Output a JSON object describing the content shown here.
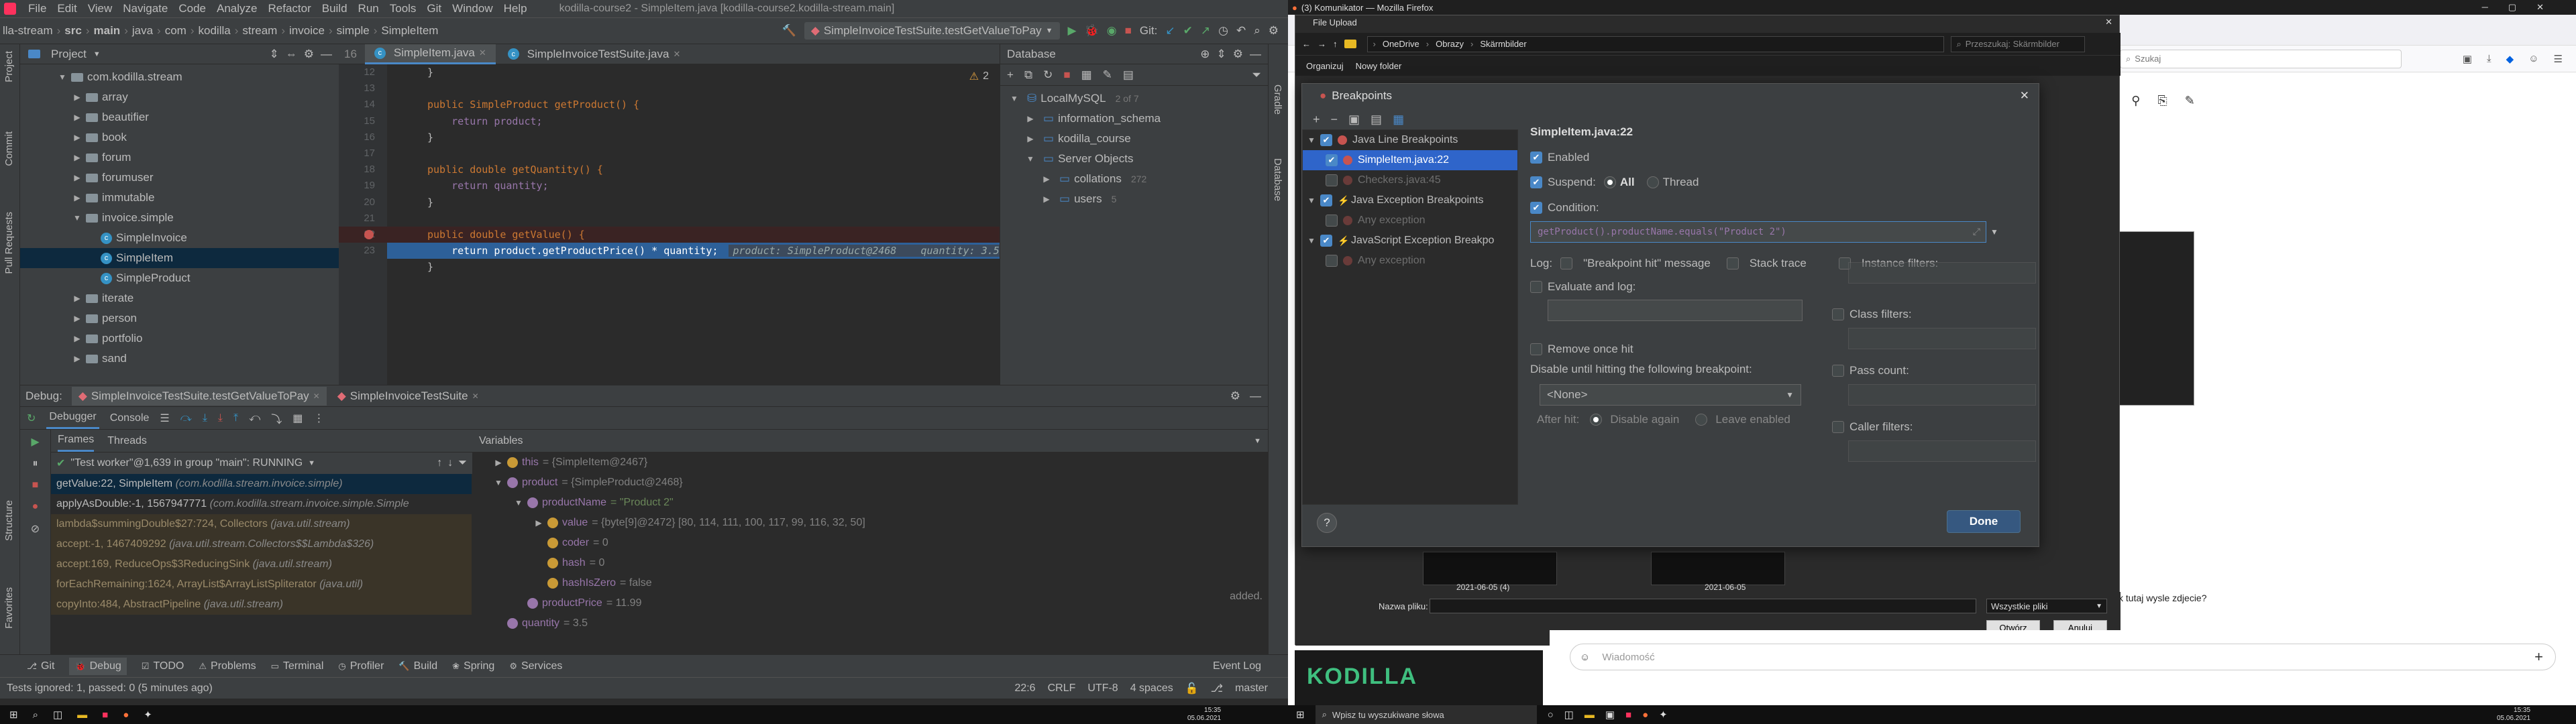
{
  "ide": {
    "menu": [
      "File",
      "Edit",
      "View",
      "Navigate",
      "Code",
      "Analyze",
      "Refactor",
      "Build",
      "Run",
      "Tools",
      "Git",
      "Window",
      "Help"
    ],
    "window_title": "kodilla-course2 - SimpleItem.java [kodilla-course2.kodilla-stream.main]",
    "breadcrumb": [
      "lla-stream",
      "src",
      "main",
      "java",
      "com",
      "kodilla",
      "stream",
      "invoice",
      "simple",
      "SimpleItem"
    ],
    "run_config": "SimpleInvoiceTestSuite.testGetValueToPay",
    "git_label": "Git:",
    "project": {
      "title": "Project",
      "tree": [
        {
          "label": "com.kodilla.stream",
          "type": "package",
          "indent": 3,
          "open": true
        },
        {
          "label": "array",
          "type": "package",
          "indent": 4
        },
        {
          "label": "beautifier",
          "type": "package",
          "indent": 4
        },
        {
          "label": "book",
          "type": "package",
          "indent": 4
        },
        {
          "label": "forum",
          "type": "package",
          "indent": 4
        },
        {
          "label": "forumuser",
          "type": "package",
          "indent": 4
        },
        {
          "label": "immutable",
          "type": "package",
          "indent": 4
        },
        {
          "label": "invoice.simple",
          "type": "package",
          "indent": 4,
          "open": true
        },
        {
          "label": "SimpleInvoice",
          "type": "class",
          "indent": 5
        },
        {
          "label": "SimpleItem",
          "type": "class",
          "indent": 5,
          "selected": true
        },
        {
          "label": "SimpleProduct",
          "type": "class",
          "indent": 5
        },
        {
          "label": "iterate",
          "type": "package",
          "indent": 4
        },
        {
          "label": "person",
          "type": "package",
          "indent": 4
        },
        {
          "label": "portfolio",
          "type": "package",
          "indent": 4
        },
        {
          "label": "sand",
          "type": "package",
          "indent": 4
        }
      ],
      "badge": "16"
    },
    "editor": {
      "tabs": [
        {
          "label": "SimpleItem.java",
          "active": true
        },
        {
          "label": "SimpleInvoiceTestSuite.java",
          "active": false
        }
      ],
      "warnings": "2",
      "line_numbers": [
        "12",
        "13",
        "14",
        "15",
        "16",
        "17",
        "18",
        "19",
        "20",
        "21",
        "22",
        "23"
      ],
      "lines": [
        {
          "t": "}"
        },
        {
          "t": ""
        },
        {
          "t": "public SimpleProduct getProduct() {"
        },
        {
          "t": "    return product;"
        },
        {
          "t": "}"
        },
        {
          "t": ""
        },
        {
          "t": "public double getQuantity() {"
        },
        {
          "t": "    return quantity;"
        },
        {
          "t": "}"
        },
        {
          "t": ""
        },
        {
          "t": "public double getValue() {"
        },
        {
          "t": "    return product.getProductPrice() * quantity;"
        },
        {
          "t": "}"
        }
      ],
      "inline_debug": "product: SimpleProduct@2468    quantity: 3.5"
    },
    "database": {
      "title": "Database",
      "items": [
        {
          "label": "LocalMySQL",
          "count": "2 of 7",
          "indent": 0
        },
        {
          "label": "information_schema",
          "indent": 1
        },
        {
          "label": "kodilla_course",
          "indent": 1
        },
        {
          "label": "Server Objects",
          "indent": 1,
          "open": true
        },
        {
          "label": "collations",
          "count": "272",
          "indent": 2
        },
        {
          "label": "users",
          "count": "5",
          "indent": 2
        }
      ]
    },
    "debug": {
      "label": "Debug:",
      "tabs": [
        "SimpleInvoiceTestSuite.testGetValueToPay",
        "SimpleInvoiceTestSuite"
      ],
      "subtabs": [
        "Debugger",
        "Console"
      ],
      "frames_tab": "Frames",
      "threads_tab": "Threads",
      "variables_tab": "Variables",
      "thread": "\"Test worker\"@1,639 in group \"main\": RUNNING",
      "frames": [
        {
          "m": "getValue:22, SimpleItem",
          "c": "(com.kodilla.stream.invoice.simple)",
          "sel": true
        },
        {
          "m": "applyAsDouble:-1, 1567947771",
          "c": "(com.kodilla.stream.invoice.simple.Simple"
        },
        {
          "m": "lambda$summingDouble$27:724, Collectors",
          "c": "(java.util.stream)",
          "lib": true
        },
        {
          "m": "accept:-1, 1467409292",
          "c": "(java.util.stream.Collectors$$Lambda$326)",
          "lib": true
        },
        {
          "m": "accept:169, ReduceOps$3ReducingSink",
          "c": "(java.util.stream)",
          "lib": true
        },
        {
          "m": "forEachRemaining:1624, ArrayList$ArrayListSpliterator",
          "c": "(java.util)",
          "lib": true
        },
        {
          "m": "copyInto:484, AbstractPipeline",
          "c": "(java.util.stream)",
          "lib": true
        }
      ],
      "variables": [
        {
          "indent": 0,
          "name": "this",
          "val": "= {SimpleItem@2467}",
          "arrow": "▶"
        },
        {
          "indent": 0,
          "name": "product",
          "val": "= {SimpleProduct@2468}",
          "arrow": "▼"
        },
        {
          "indent": 1,
          "name": "productName",
          "val": "= \"Product 2\"",
          "str": true,
          "arrow": "▼"
        },
        {
          "indent": 2,
          "name": "value",
          "val": "= {byte[9]@2472} [80, 114, 111, 100, 117, 99, 116, 32, 50]",
          "arrow": "▶"
        },
        {
          "indent": 2,
          "name": "coder",
          "val": "= 0"
        },
        {
          "indent": 2,
          "name": "hash",
          "val": "= 0"
        },
        {
          "indent": 2,
          "name": "hashIsZero",
          "val": "= false"
        },
        {
          "indent": 1,
          "name": "productPrice",
          "val": "= 11.99"
        },
        {
          "indent": 0,
          "name": "quantity",
          "val": "= 3.5"
        }
      ],
      "side_text": "added."
    },
    "bottom_tools": [
      "Git",
      "Debug",
      "TODO",
      "Problems",
      "Terminal",
      "Profiler",
      "Build",
      "Spring",
      "Services"
    ],
    "event_log": "Event Log",
    "status": {
      "left": "Tests ignored: 1, passed: 0 (5 minutes ago)",
      "pos": "22:6",
      "crlf": "CRLF",
      "enc": "UTF-8",
      "indent": "4 spaces",
      "branch": "master"
    },
    "left_vtabs": [
      "Project",
      "Commit",
      "Pull Requests",
      "Structure",
      "Favorites"
    ],
    "right_vtabs": [
      "Gradle",
      "Database"
    ]
  },
  "firefox": {
    "title": "(3) Komunikator — Mozilla Firefox",
    "search_placeholder": "Szukaj",
    "chat_text": "k tutaj wysle zdjecie?",
    "chat_input_placeholder": "Wiadomość"
  },
  "fileupload": {
    "title": "File Upload",
    "path": [
      "OneDrive",
      "Obrazy",
      "Skärmbilder"
    ],
    "search_placeholder": "Przeszukaj: Skärmbilder",
    "organize": "Organizuj",
    "new_folder": "Nowy folder",
    "thumbs": [
      "2021-06-05 (4)",
      "2021-06-05"
    ],
    "filename_label": "Nazwa pliku:",
    "filter": "Wszystkie pliki",
    "open": "Otwórz",
    "cancel": "Anuluj"
  },
  "breakpoints": {
    "title": "Breakpoints",
    "list": [
      {
        "label": "Java Line Breakpoints",
        "indent": 0,
        "group": true,
        "checked": true
      },
      {
        "label": "SimpleItem.java:22",
        "indent": 1,
        "checked": true,
        "selected": true
      },
      {
        "label": "Checkers.java:45",
        "indent": 1,
        "checked": false,
        "dim": true
      },
      {
        "label": "Java Exception Breakpoints",
        "indent": 0,
        "group": true,
        "checked": true
      },
      {
        "label": "Any exception",
        "indent": 1,
        "checked": false,
        "dim": true
      },
      {
        "label": "JavaScript Exception Breakpo",
        "indent": 0,
        "group": true,
        "checked": true
      },
      {
        "label": "Any exception",
        "indent": 1,
        "checked": false,
        "dim": true
      }
    ],
    "selected_title": "SimpleItem.java:22",
    "enabled": "Enabled",
    "suspend": "Suspend:",
    "all": "All",
    "thread": "Thread",
    "condition": "Condition:",
    "condition_value": "getProduct().productName.equals(\"Product 2\")",
    "log": "Log:",
    "log_msg": "\"Breakpoint hit\" message",
    "stack_trace": "Stack trace",
    "evaluate_log": "Evaluate and log:",
    "instance_filters": "Instance filters:",
    "class_filters": "Class filters:",
    "pass_count": "Pass count:",
    "caller_filters": "Caller filters:",
    "remove_once": "Remove once hit",
    "disable_until": "Disable until hitting the following breakpoint:",
    "none": "<None>",
    "after_hit": "After hit:",
    "disable_again": "Disable again",
    "leave_enabled": "Leave enabled",
    "done": "Done",
    "help": "?"
  },
  "kodilla": {
    "logo": "KODILLA"
  },
  "taskbar": {
    "search_placeholder": "Wpisz tu wyszukiwane słowa",
    "time1": "15:35",
    "date1": "05.06.2021",
    "time2": "15:35",
    "date2": "05.06.2021"
  },
  "colors": {
    "accent": "#4a88c7",
    "breakpoint": "#c75450",
    "done": "#365880"
  }
}
